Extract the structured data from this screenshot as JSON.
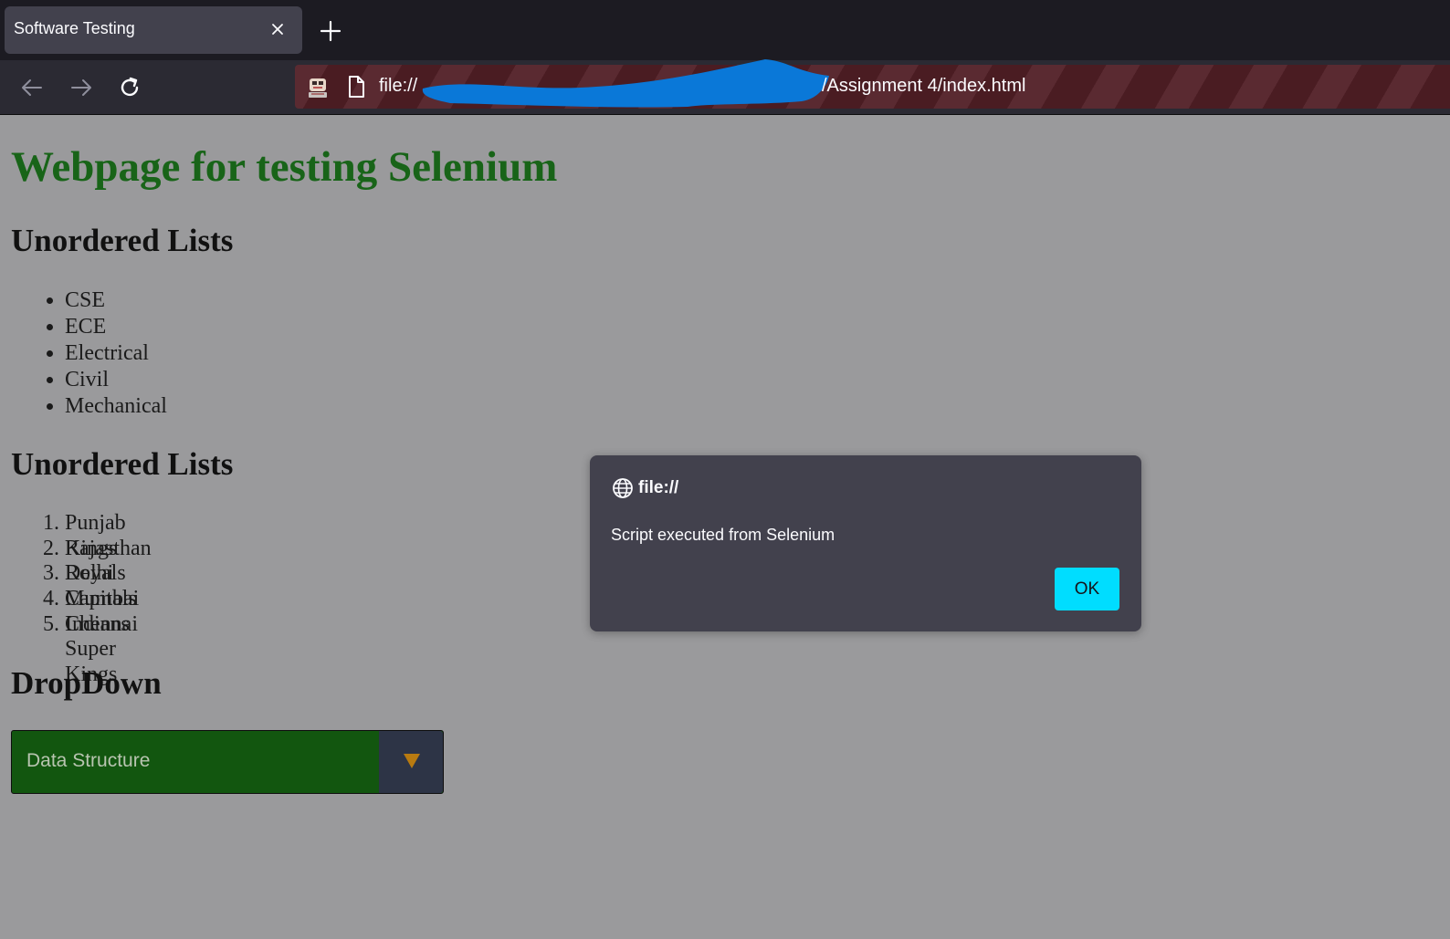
{
  "browser": {
    "tab_title": "Software Testing",
    "url_prefix": "file://",
    "url_suffix": "/Assignment 4/index.html"
  },
  "page": {
    "heading": "Webpage for testing Selenium",
    "unordered_heading": "Unordered Lists",
    "unordered_items": [
      "CSE",
      "ECE",
      "Electrical",
      "Civil",
      "Mechanical"
    ],
    "ordered_heading": "Unordered Lists",
    "ordered_items": [
      "Punjab Kings",
      "Rajasthan Royals",
      "Delhi Capitals",
      "Mumbai Indians",
      "Chennai Super Kings"
    ],
    "dropdown_heading": "DropDown",
    "dropdown_value": "Data Structure"
  },
  "dialog": {
    "origin": "file://",
    "message": "Script executed from Selenium",
    "ok_label": "OK"
  },
  "colors": {
    "heading_green": "#186418",
    "dropdown_green": "#12560f",
    "ok_button": "#00ddff",
    "dialog_bg": "#42414d",
    "page_bg_dimmed": "#9a9a9c"
  }
}
